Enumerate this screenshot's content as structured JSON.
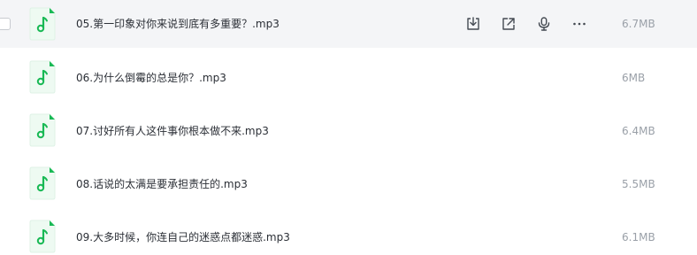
{
  "files": [
    {
      "name": "05.第一印象对你来说到底有多重要？.mp3",
      "size": "6.7MB"
    },
    {
      "name": "06.为什么倒霉的总是你？.mp3",
      "size": "6MB"
    },
    {
      "name": "07.讨好所有人这件事你根本做不来.mp3",
      "size": "6.4MB"
    },
    {
      "name": "08.话说的太满是要承担责任的.mp3",
      "size": "5.5MB"
    },
    {
      "name": "09.大多时候，你连自己的迷惑点都迷惑.mp3",
      "size": "6.1MB"
    }
  ],
  "actions": {
    "download_icon": "download-icon",
    "share_icon": "share-icon",
    "voice_icon": "voice-icon",
    "more_icon": "more-icon"
  },
  "colors": {
    "accent_green": "#19b955",
    "hover_background": "#f4f5f7",
    "text_primary": "#2b2f36",
    "text_secondary": "#9aa0a8"
  }
}
